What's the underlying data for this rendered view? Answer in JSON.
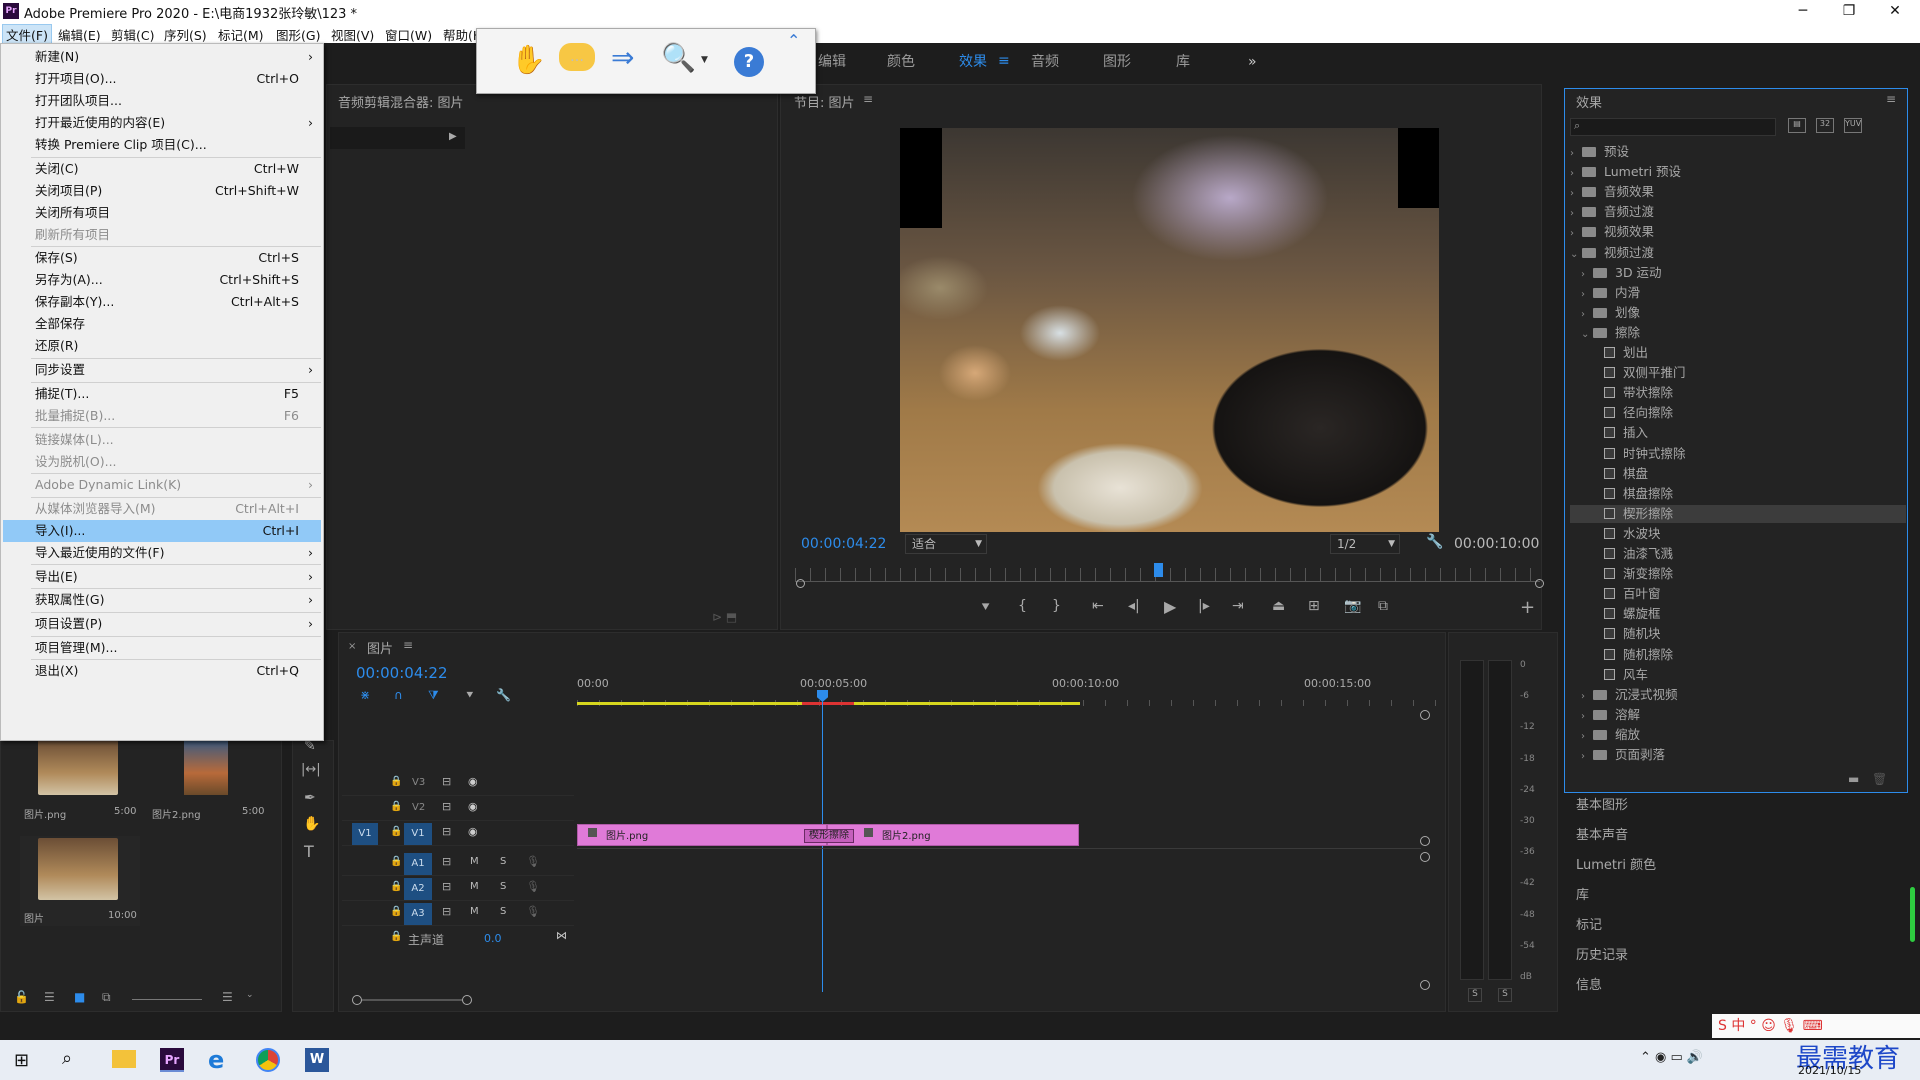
{
  "app": {
    "title": "Adobe Premiere Pro 2020 - E:\\电商1932张玲敏\\123 *",
    "icon": "Pr"
  },
  "menubar": [
    "文件(F)",
    "编辑(E)",
    "剪辑(C)",
    "序列(S)",
    "标记(M)",
    "图形(G)",
    "视图(V)",
    "窗口(W)",
    "帮助(H)"
  ],
  "window_controls": [
    "minimize-icon",
    "restore-icon",
    "close-icon"
  ],
  "workspaces": [
    "编辑",
    "颜色",
    "效果",
    "音频",
    "图形",
    "库"
  ],
  "workspace_active": "效果",
  "file_menu": [
    {
      "label": "新建(N)",
      "shortcut": "",
      "submenu": true,
      "disabled": false
    },
    {
      "label": "打开项目(O)...",
      "shortcut": "Ctrl+O",
      "submenu": false,
      "disabled": false
    },
    {
      "label": "打开团队项目...",
      "shortcut": "",
      "submenu": false,
      "disabled": false
    },
    {
      "label": "打开最近使用的内容(E)",
      "shortcut": "",
      "submenu": true,
      "disabled": false
    },
    {
      "label": "转换 Premiere Clip 项目(C)...",
      "shortcut": "",
      "submenu": false,
      "disabled": false
    },
    {
      "label": "关闭(C)",
      "shortcut": "Ctrl+W",
      "submenu": false,
      "disabled": false
    },
    {
      "label": "关闭项目(P)",
      "shortcut": "Ctrl+Shift+W",
      "submenu": false,
      "disabled": false
    },
    {
      "label": "关闭所有项目",
      "shortcut": "",
      "submenu": false,
      "disabled": false
    },
    {
      "label": "刷新所有项目",
      "shortcut": "",
      "submenu": false,
      "disabled": true
    },
    {
      "label": "保存(S)",
      "shortcut": "Ctrl+S",
      "submenu": false,
      "disabled": false
    },
    {
      "label": "另存为(A)...",
      "shortcut": "Ctrl+Shift+S",
      "submenu": false,
      "disabled": false
    },
    {
      "label": "保存副本(Y)...",
      "shortcut": "Ctrl+Alt+S",
      "submenu": false,
      "disabled": false
    },
    {
      "label": "全部保存",
      "shortcut": "",
      "submenu": false,
      "disabled": false
    },
    {
      "label": "还原(R)",
      "shortcut": "",
      "submenu": false,
      "disabled": false
    },
    {
      "label": "同步设置",
      "shortcut": "",
      "submenu": true,
      "disabled": false
    },
    {
      "label": "捕捉(T)...",
      "shortcut": "F5",
      "submenu": false,
      "disabled": false
    },
    {
      "label": "批量捕捉(B)...",
      "shortcut": "F6",
      "submenu": false,
      "disabled": true
    },
    {
      "label": "链接媒体(L)...",
      "shortcut": "",
      "submenu": false,
      "disabled": true
    },
    {
      "label": "设为脱机(O)...",
      "shortcut": "",
      "submenu": false,
      "disabled": true
    },
    {
      "label": "Adobe Dynamic Link(K)",
      "shortcut": "",
      "submenu": true,
      "disabled": true
    },
    {
      "label": "从媒体浏览器导入(M)",
      "shortcut": "Ctrl+Alt+I",
      "submenu": false,
      "disabled": true
    },
    {
      "label": "导入(I)...",
      "shortcut": "Ctrl+I",
      "submenu": false,
      "disabled": false,
      "highlighted": true
    },
    {
      "label": "导入最近使用的文件(F)",
      "shortcut": "",
      "submenu": true,
      "disabled": false
    },
    {
      "label": "导出(E)",
      "shortcut": "",
      "submenu": true,
      "disabled": false
    },
    {
      "label": "获取属性(G)",
      "shortcut": "",
      "submenu": true,
      "disabled": false
    },
    {
      "label": "项目设置(P)",
      "shortcut": "",
      "submenu": true,
      "disabled": false
    },
    {
      "label": "项目管理(M)...",
      "shortcut": "",
      "submenu": false,
      "disabled": false
    },
    {
      "label": "退出(X)",
      "shortcut": "Ctrl+Q",
      "submenu": false,
      "disabled": false
    }
  ],
  "floating_toolbar": [
    "hand-icon",
    "comment-icon",
    "export-icon",
    "zoom-icon",
    "help-icon",
    "collapse-icon"
  ],
  "audio_mixer": {
    "title": "音频剪辑混合器: 图片"
  },
  "program_monitor": {
    "title": "节目: 图片",
    "timecode": "00:00:04:22",
    "fit": "适合",
    "resolution": "1/2",
    "duration": "00:00:10:00",
    "playhead_fraction": 0.486
  },
  "transport": [
    "marker-icon",
    "in-point-icon",
    "out-point-icon",
    "go-to-in-icon",
    "step-back-icon",
    "play-icon",
    "step-forward-icon",
    "go-to-out-icon",
    "lift-icon",
    "extract-icon",
    "camera-icon",
    "compare-icon",
    "add-icon"
  ],
  "project": {
    "items": [
      {
        "name": "图片.png",
        "duration": "5:00"
      },
      {
        "name": "图片2.png",
        "duration": "5:00"
      },
      {
        "name": "图片",
        "duration": "10:00"
      }
    ]
  },
  "timeline": {
    "tab": "图片",
    "timecode": "00:00:04:22",
    "ruler": [
      "00:00",
      "00:00:05:00",
      "00:00:10:00",
      "00:00:15:00"
    ],
    "tracks": [
      "V3",
      "V2",
      "V1",
      "A1",
      "A2",
      "A3"
    ],
    "master": "主声道",
    "master_value": "0.0",
    "source_patch": "V1",
    "clips": [
      {
        "name": "图片.png"
      },
      {
        "name": "图片2.png"
      }
    ],
    "transition": "楔形擦除"
  },
  "meter": {
    "scale": [
      "0",
      "-6",
      "-12",
      "-18",
      "-24",
      "-30",
      "-36",
      "-42",
      "-48",
      "-54",
      "dB"
    ],
    "solo": [
      "S",
      "S"
    ]
  },
  "effects": {
    "title": "效果",
    "search_placeholder": "",
    "tree": [
      {
        "label": "预设",
        "level": 0,
        "type": "bin",
        "open": false
      },
      {
        "label": "Lumetri 预设",
        "level": 0,
        "type": "bin",
        "open": false
      },
      {
        "label": "音频效果",
        "level": 0,
        "type": "folder",
        "open": false
      },
      {
        "label": "音频过渡",
        "level": 0,
        "type": "folder",
        "open": false
      },
      {
        "label": "视频效果",
        "level": 0,
        "type": "folder",
        "open": false
      },
      {
        "label": "视频过渡",
        "level": 0,
        "type": "folder",
        "open": true
      },
      {
        "label": "3D 运动",
        "level": 1,
        "type": "folder",
        "open": false
      },
      {
        "label": "内滑",
        "level": 1,
        "type": "folder",
        "open": false
      },
      {
        "label": "划像",
        "level": 1,
        "type": "folder",
        "open": false
      },
      {
        "label": "擦除",
        "level": 1,
        "type": "folder",
        "open": true
      },
      {
        "label": "划出",
        "level": 2,
        "type": "fx"
      },
      {
        "label": "双侧平推门",
        "level": 2,
        "type": "fx"
      },
      {
        "label": "带状擦除",
        "level": 2,
        "type": "fx"
      },
      {
        "label": "径向擦除",
        "level": 2,
        "type": "fx"
      },
      {
        "label": "插入",
        "level": 2,
        "type": "fx"
      },
      {
        "label": "时钟式擦除",
        "level": 2,
        "type": "fx"
      },
      {
        "label": "棋盘",
        "level": 2,
        "type": "fx"
      },
      {
        "label": "棋盘擦除",
        "level": 2,
        "type": "fx"
      },
      {
        "label": "楔形擦除",
        "level": 2,
        "type": "fx",
        "selected": true
      },
      {
        "label": "水波块",
        "level": 2,
        "type": "fx"
      },
      {
        "label": "油漆飞溅",
        "level": 2,
        "type": "fx"
      },
      {
        "label": "渐变擦除",
        "level": 2,
        "type": "fx"
      },
      {
        "label": "百叶窗",
        "level": 2,
        "type": "fx"
      },
      {
        "label": "螺旋框",
        "level": 2,
        "type": "fx"
      },
      {
        "label": "随机块",
        "level": 2,
        "type": "fx"
      },
      {
        "label": "随机擦除",
        "level": 2,
        "type": "fx"
      },
      {
        "label": "风车",
        "level": 2,
        "type": "fx"
      },
      {
        "label": "沉浸式视频",
        "level": 1,
        "type": "folder",
        "open": false
      },
      {
        "label": "溶解",
        "level": 1,
        "type": "folder",
        "open": false
      },
      {
        "label": "缩放",
        "level": 1,
        "type": "folder",
        "open": false
      },
      {
        "label": "页面剥落",
        "level": 1,
        "type": "folder",
        "open": false
      }
    ]
  },
  "side_panels": [
    "基本图形",
    "基本声音",
    "Lumetri 颜色",
    "库",
    "标记",
    "历史记录",
    "信息"
  ],
  "taskbar": {
    "date": "2021/10/15",
    "watermark": "最需教育",
    "apps": [
      "windows-icon",
      "search-icon",
      "explorer-icon",
      "premiere-icon",
      "edge-icon",
      "chrome-icon",
      "word-icon"
    ],
    "app_labels": {
      "premiere": "Pr",
      "word": "W",
      "edge": "e"
    }
  },
  "colors": {
    "accent_blue": "#2d8ceb",
    "clip_pink": "#e07ad8",
    "menu_highlight": "#91c9f7",
    "premiere_purple": "#2a0a3c"
  }
}
